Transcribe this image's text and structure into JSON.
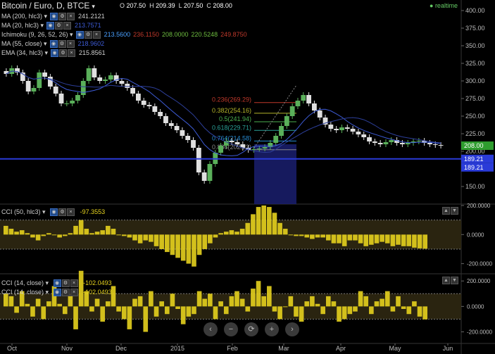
{
  "header": {
    "symbol": "Bitcoin / Euro, D, BTCE",
    "ohlc_o_label": "O",
    "ohlc_o": "207.50",
    "ohlc_h_label": "H",
    "ohlc_h": "209.39",
    "ohlc_l_label": "L",
    "ohlc_l": "207.50",
    "ohlc_c_label": "C",
    "ohlc_c": "208.00",
    "realtime": "realtime"
  },
  "indicators": [
    {
      "name": "MA (200, hlc3)",
      "values": [
        "241.2121"
      ],
      "colors": [
        "#cfcfcf"
      ]
    },
    {
      "name": "MA (20, hlc3)",
      "values": [
        "213.7571"
      ],
      "colors": [
        "#3d5bd6"
      ]
    },
    {
      "name": "Ichimoku (9, 26, 52, 26)",
      "values": [
        "213.5600",
        "236.1150",
        "208.0000",
        "220.5248",
        "249.8750"
      ],
      "colors": [
        "#4aa0ff",
        "#c0392b",
        "#6fbf40",
        "#6fbf40",
        "#c0392b"
      ]
    },
    {
      "name": "MA (55, close)",
      "values": [
        "218.9602"
      ],
      "colors": [
        "#3d5bd6"
      ]
    },
    {
      "name": "EMA (34, hlc3)",
      "values": [
        "215.8561"
      ],
      "colors": [
        "#cfcfcf"
      ]
    }
  ],
  "cci1": {
    "name": "CCI (50, hlc3)",
    "value": "-97.3553"
  },
  "cci2": [
    {
      "name": "CCI (14, close)",
      "value": "-102.0493"
    },
    {
      "name": "CCI (14, close)",
      "value": "-102.0493"
    }
  ],
  "colors": {
    "candle_up": "#5ab05a",
    "candle_down": "#e0e0e0",
    "ma": "#3d5bd6",
    "cci": "#e6d21e",
    "fib_box": "#1a1f6e"
  },
  "fib_levels": [
    {
      "label": "0.236(269.29)",
      "price": 269.29,
      "color": "#c0392b"
    },
    {
      "label": "0.382(254.16)",
      "price": 254.16,
      "color": "#b5b52a"
    },
    {
      "label": "0.5(241.94)",
      "price": 241.94,
      "color": "#4caf50"
    },
    {
      "label": "0.618(229.71)",
      "price": 229.71,
      "color": "#2aa198"
    },
    {
      "label": "0.764(214.58)",
      "price": 214.58,
      "color": "#268bd2"
    },
    {
      "label": "0.886(202.23)",
      "price": 202.23,
      "color": "#888888"
    }
  ],
  "price_labels": {
    "last": "208.00",
    "level1": "189.21",
    "level2": "189.21"
  },
  "chart_data": [
    {
      "type": "line",
      "title": "Bitcoin / Euro, D, BTCE",
      "x_ticks": [
        "Oct",
        "Nov",
        "Dec",
        "2015",
        "Feb",
        "Mar",
        "Apr",
        "May",
        "Jun"
      ],
      "y_ticks": [
        "400.00",
        "375.00",
        "350.00",
        "325.00",
        "300.00",
        "275.00",
        "250.00",
        "225.00",
        "200.00",
        "175.00",
        "150.00"
      ],
      "ylim": [
        125,
        405
      ],
      "series": [
        {
          "name": "close",
          "values": [
            310,
            318,
            312,
            300,
            285,
            290,
            312,
            306,
            292,
            282,
            268,
            268,
            272,
            280,
            300,
            318,
            305,
            300,
            302,
            308,
            300,
            296,
            290,
            282,
            272,
            266,
            264,
            256,
            250,
            240,
            236,
            230,
            222,
            216,
            205,
            170,
            158,
            182,
            198,
            208,
            215,
            213,
            210,
            205,
            202,
            203,
            204,
            206,
            212,
            222,
            236,
            250,
            264,
            272,
            280,
            268,
            258,
            248,
            238,
            232,
            230,
            234,
            232,
            228,
            224,
            220,
            214,
            212,
            210,
            213,
            216,
            212,
            210,
            212,
            214,
            215,
            212,
            210,
            209,
            208
          ]
        }
      ]
    },
    {
      "type": "bar",
      "title": "CCI (50, hlc3)",
      "y_ticks": [
        "200.0000",
        "0.0000",
        "-200.0000"
      ],
      "ylim": [
        -260,
        200
      ],
      "series": [
        {
          "name": "CCI (50, hlc3)",
          "values": [
            60,
            40,
            20,
            30,
            10,
            -20,
            -40,
            -10,
            10,
            0,
            -20,
            -10,
            10,
            60,
            100,
            40,
            10,
            20,
            30,
            60,
            40,
            0,
            -10,
            -20,
            -40,
            -60,
            -40,
            -50,
            -80,
            -100,
            -120,
            -140,
            -160,
            -180,
            -200,
            -220,
            -140,
            -100,
            -60,
            -20,
            10,
            20,
            30,
            20,
            40,
            80,
            140,
            190,
            200,
            190,
            150,
            80,
            40,
            0,
            -10,
            -10,
            -20,
            -30,
            -20,
            -20,
            -40,
            -60,
            -60,
            -80,
            -40,
            -40,
            -60,
            -80,
            -70,
            -60,
            -50,
            -60,
            -80,
            -70,
            -80,
            -80,
            -90,
            -95,
            -97
          ]
        }
      ]
    },
    {
      "type": "bar",
      "title": "CCI (14, close)",
      "y_ticks": [
        "200.0000",
        "0.0000",
        "-200.0000"
      ],
      "ylim": [
        -280,
        240
      ],
      "series": [
        {
          "name": "CCI (14, close)",
          "values": [
            100,
            80,
            -50,
            120,
            20,
            -80,
            60,
            -100,
            40,
            160,
            20,
            -60,
            80,
            -180,
            280,
            120,
            -40,
            60,
            -120,
            40,
            160,
            -40,
            -100,
            -180,
            60,
            80,
            -200,
            120,
            -80,
            40,
            -60,
            100,
            -20,
            -140,
            -80,
            -60,
            120,
            60,
            100,
            -100,
            40,
            -60,
            80,
            120,
            60,
            -40,
            140,
            200,
            80,
            160,
            -40,
            -100,
            0,
            80,
            -80,
            -120,
            40,
            80,
            20,
            -60,
            80,
            40,
            -120,
            -100,
            -60,
            -40,
            120,
            80,
            -60,
            40,
            60,
            120,
            -40,
            80,
            -20,
            -60,
            40,
            -80,
            -102
          ]
        }
      ]
    }
  ],
  "x_labels": [
    "Oct",
    "Nov",
    "Dec",
    "2015",
    "Feb",
    "Mar",
    "Apr",
    "May",
    "Jun"
  ],
  "nav_buttons": [
    {
      "name": "scroll-left",
      "glyph": "‹"
    },
    {
      "name": "zoom-out",
      "glyph": "−"
    },
    {
      "name": "reset",
      "glyph": "⟳"
    },
    {
      "name": "zoom-in",
      "glyph": "+"
    },
    {
      "name": "scroll-right",
      "glyph": "›"
    }
  ]
}
